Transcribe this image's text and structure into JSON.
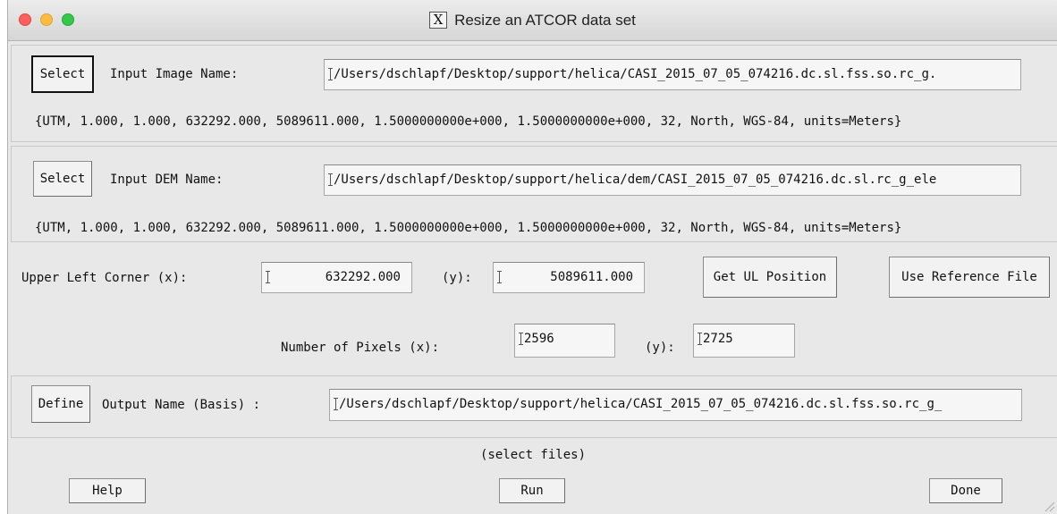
{
  "window": {
    "title": "Resize an ATCOR data set",
    "title_icon": "X"
  },
  "input_image": {
    "select_label": "Select",
    "label": "Input Image Name:",
    "path": "/Users/dschlapf/Desktop/support/helica/CASI_2015_07_05_074216.dc.sl.fss.so.rc_g.",
    "map_info": "{UTM, 1.000, 1.000, 632292.000, 5089611.000, 1.5000000000e+000, 1.5000000000e+000, 32, North, WGS-84, units=Meters}"
  },
  "input_dem": {
    "select_label": "Select",
    "label": "Input DEM Name:",
    "path": "/Users/dschlapf/Desktop/support/helica/dem/CASI_2015_07_05_074216.dc.sl.rc_g_ele",
    "map_info": "{UTM, 1.000, 1.000, 632292.000, 5089611.000, 1.5000000000e+000, 1.5000000000e+000, 32, North, WGS-84, units=Meters}"
  },
  "upper_left": {
    "label_x": "Upper Left Corner (x):",
    "value_x": "632292.000",
    "label_y": "(y):",
    "value_y": "5089611.000",
    "get_ul_label": "Get UL Position",
    "use_ref_label": "Use Reference File"
  },
  "pixels": {
    "label_x": "Number of Pixels (x):",
    "value_x": "2596",
    "label_y": "(y):",
    "value_y": "2725"
  },
  "output": {
    "define_label": "Define",
    "label": "Output Name (Basis) :",
    "path": "/Users/dschlapf/Desktop/support/helica/CASI_2015_07_05_074216.dc.sl.fss.so.rc_g_"
  },
  "status": "(select files)",
  "footer": {
    "help_label": "Help",
    "run_label": "Run",
    "done_label": "Done"
  }
}
